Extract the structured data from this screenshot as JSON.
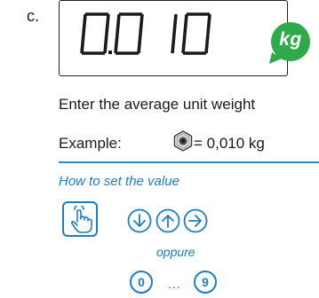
{
  "step": {
    "letter": "c."
  },
  "display": {
    "reading": "0.010",
    "unit": "kg",
    "unit_badge_color": "#2eaa4a",
    "border_color": "#222222"
  },
  "instruction": "Enter the average unit weight",
  "example": {
    "label": "Example:",
    "icon": "hex-nut-icon",
    "value": "= 0,010 kg"
  },
  "howto": {
    "title": "How to set the value",
    "accent_color": "#1c7dc8",
    "press_icon": "hand-press-icon",
    "arrow_buttons": [
      "arrow-down-icon",
      "arrow-up-icon",
      "arrow-right-icon"
    ],
    "separator": "oppure",
    "digit_first": "0",
    "digit_ellipsis": "...",
    "digit_last": "9"
  }
}
